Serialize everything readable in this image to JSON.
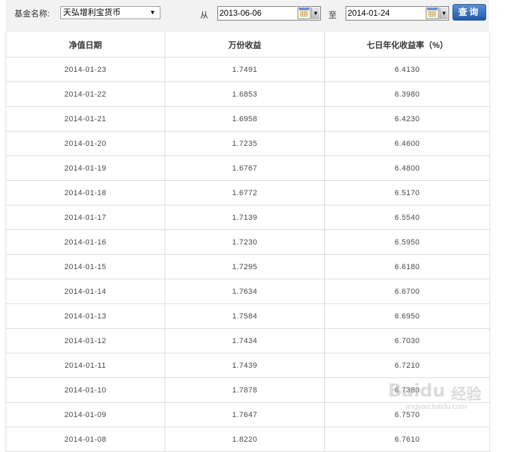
{
  "filter": {
    "fund_label": "基金名称:",
    "fund_selected": "天弘增利宝货币",
    "from_label": "从",
    "from_date": "2013-06-06",
    "to_label": "至",
    "to_date": "2014-01-24",
    "query_button": "查询"
  },
  "table": {
    "headers": [
      "净值日期",
      "万份收益",
      "七日年化收益率（%）"
    ],
    "rows": [
      [
        "2014-01-23",
        "1.7491",
        "6.4130"
      ],
      [
        "2014-01-22",
        "1.6853",
        "6.3980"
      ],
      [
        "2014-01-21",
        "1.6958",
        "6.4230"
      ],
      [
        "2014-01-20",
        "1.7235",
        "6.4600"
      ],
      [
        "2014-01-19",
        "1.6767",
        "6.4800"
      ],
      [
        "2014-01-18",
        "1.6772",
        "6.5170"
      ],
      [
        "2014-01-17",
        "1.7139",
        "6.5540"
      ],
      [
        "2014-01-16",
        "1.7230",
        "6.5950"
      ],
      [
        "2014-01-15",
        "1.7295",
        "6.6180"
      ],
      [
        "2014-01-14",
        "1.7634",
        "6.6700"
      ],
      [
        "2014-01-13",
        "1.7584",
        "6.6950"
      ],
      [
        "2014-01-12",
        "1.7434",
        "6.7030"
      ],
      [
        "2014-01-11",
        "1.7439",
        "6.7210"
      ],
      [
        "2014-01-10",
        "1.7878",
        "6.7380"
      ],
      [
        "2014-01-09",
        "1.7647",
        "6.7570"
      ],
      [
        "2014-01-08",
        "1.8220",
        "6.7610"
      ]
    ]
  },
  "watermark": {
    "brand": "Baidu",
    "cn": "经验",
    "url": "jingyan.baidu.com"
  },
  "icons": [
    "calendar-icon",
    "dropdown-arrow-icon"
  ]
}
